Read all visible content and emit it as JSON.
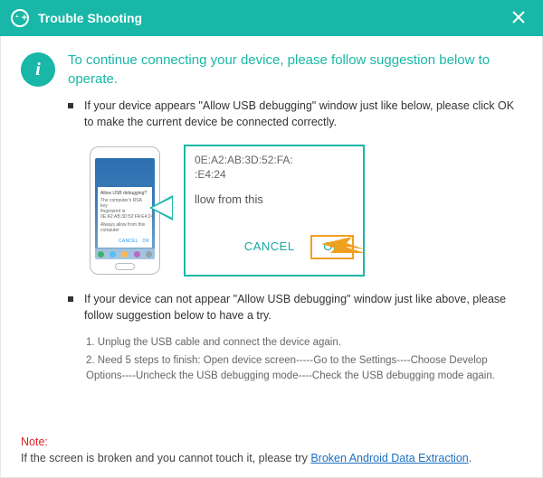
{
  "header": {
    "title": "Trouble Shooting"
  },
  "intro": "To continue connecting your device, please follow suggestion below to operate.",
  "bullet1": "If your device appears \"Allow USB debugging\" window just like below, please click OK to make the current device  be connected correctly.",
  "zoom": {
    "mac_line1": "0E:A2:AB:3D:52:FA:",
    "mac_line2": ":E4:24",
    "allow_text": "llow from this",
    "cancel": "CANCEL",
    "ok": "OK"
  },
  "phone_dialog": {
    "title": "Allow USB debugging?",
    "line1": "The computer's RSA key",
    "line2": "fingerprint is:",
    "line3": "0E:A2:AB:3D:52:FA:E4:24",
    "checkbox": "Always allow from this computer",
    "btn_cancel": "CANCEL",
    "btn_ok": "OK"
  },
  "bullet2": "If your device can not appear \"Allow USB debugging\" window just like above, please follow suggestion below to have a try.",
  "steps": {
    "s1": "1. Unplug the USB cable and connect the device again.",
    "s2": "2. Need 5 steps to finish: Open device screen-----Go to the Settings----Choose Develop Options----Uncheck the USB debugging mode----Check the USB debugging mode again."
  },
  "footer": {
    "note_label": "Note:",
    "note_text": "If the screen is broken and you cannot touch it, please try ",
    "link": "Broken Android Data Extraction",
    "period": "."
  }
}
